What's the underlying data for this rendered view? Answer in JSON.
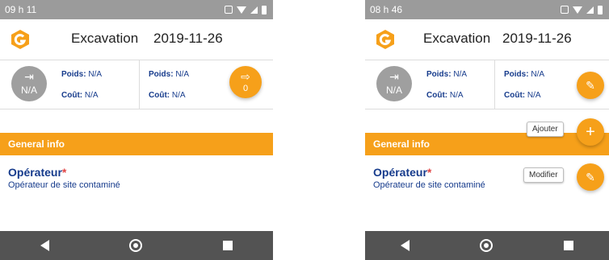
{
  "screens": [
    {
      "time": "09 h 11",
      "title": "Excavation",
      "date": "2019-11-26",
      "avatar_value": "N/A",
      "poids_label": "Poids:",
      "poids_left": "N/A",
      "cout_label": "Coût:",
      "cout_left": "N/A",
      "poids_right": "N/A",
      "cout_right": "N/A",
      "fab_value": "0",
      "section": "General info",
      "operator_label": "Opérateur",
      "required_mark": "*",
      "operator_value": "Opérateur de site contaminé"
    },
    {
      "time": "08 h 46",
      "title": "Excavation",
      "date": "2019-11-26",
      "avatar_value": "N/A",
      "poids_label": "Poids:",
      "poids_left": "N/A",
      "cout_label": "Coût:",
      "cout_left": "N/A",
      "poids_right": "N/A",
      "cout_right": "N/A",
      "section": "General info",
      "add_chip": "Ajouter",
      "add_symbol": "+",
      "operator_label": "Opérateur",
      "required_mark": "*",
      "operator_value": "Opérateur de site contaminé",
      "edit_chip": "Modifier"
    }
  ],
  "colors": {
    "accent": "#f6a01a",
    "text_blue": "#163b8c",
    "status": "#9b9b9b",
    "nav": "#535353"
  },
  "icons": [
    "vibrate-icon",
    "wifi-icon",
    "signal-icon",
    "battery-icon",
    "logo-icon",
    "arrow-in-icon",
    "arrow-out-icon",
    "edit-icon",
    "plus-icon",
    "back-icon",
    "home-icon",
    "recent-icon"
  ]
}
